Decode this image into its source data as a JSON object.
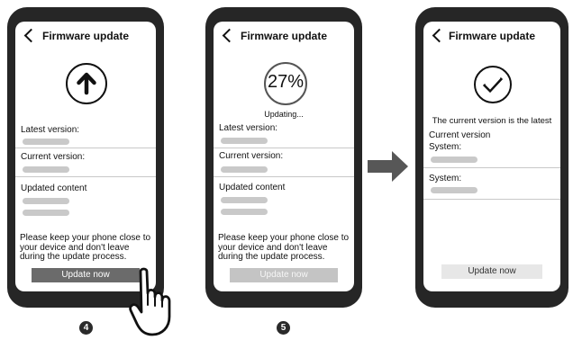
{
  "screen1": {
    "title": "Firmware update",
    "latest_label": "Latest version:",
    "current_label": "Current version:",
    "updated_label": "Updated content",
    "note": "Please keep your phone close to your device and don't leave during the update process.",
    "button": "Update now",
    "step": "4"
  },
  "screen2": {
    "title": "Firmware update",
    "progress_text": "27%",
    "progress": 27,
    "status": "Updating...",
    "latest_label": "Latest version:",
    "current_label": "Current version:",
    "updated_label": "Updated content",
    "note": "Please keep your phone close to your device and don't leave during the update process.",
    "button": "Update now",
    "step": "5"
  },
  "screen3": {
    "title": "Firmware update",
    "status": "The current version is the latest",
    "current_label": "Current version",
    "system_label_1": "System:",
    "system_label_2": "System:",
    "button": "Update now"
  },
  "icons": [
    "back-chevron-icon",
    "upload-arrow-icon",
    "checkmark-icon",
    "right-arrow-icon",
    "pointing-hand-icon"
  ],
  "colors": {
    "phone": "#262626",
    "button": "#6b6b6b",
    "placeholder": "#c9c9c9"
  }
}
